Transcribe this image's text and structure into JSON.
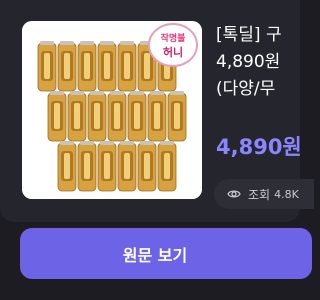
{
  "product": {
    "title_lines": [
      "[톡딜] 구",
      "4,890원",
      "(다양/무"
    ],
    "price": "4,890원",
    "views_label": "조회",
    "views_count": "4.8K",
    "image": {
      "badge_line1": "작명불",
      "badge_line2": "허니",
      "can_count": 20
    }
  },
  "cta": {
    "label": "원문 보기"
  },
  "colors": {
    "accent": "#8b85ff",
    "button": "#6c63e6",
    "background": "#1c1c22",
    "card": "#25252d"
  },
  "icons": {
    "views": "eye-icon"
  }
}
